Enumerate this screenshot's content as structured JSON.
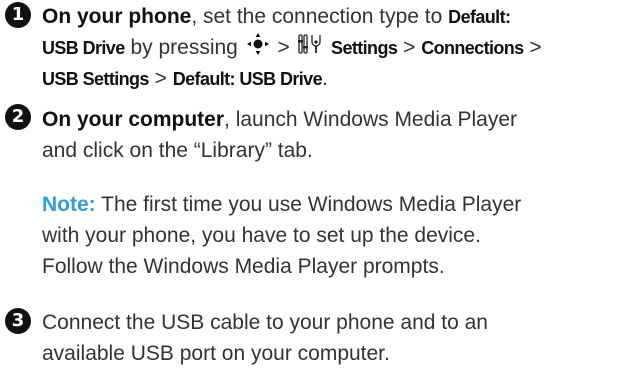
{
  "steps": [
    {
      "number": "1",
      "lead": "On your phone",
      "text_1": ", set the connection type to ",
      "term_1": "Default:",
      "term_2": "USB Drive",
      "text_2": " by pressing ",
      "nav_icon": "navigation-key-icon",
      "sep_1": " > ",
      "settings_icon": "settings-icon",
      "term_3": " Settings",
      "sep_2": " > ",
      "term_4": "Connections",
      "sep_3": " >",
      "term_5": "USB Settings",
      "sep_4": " > ",
      "term_6": "Default: USB Drive",
      "text_3": "."
    },
    {
      "number": "2",
      "lead": "On your computer",
      "text_1": ", launch Windows Media Player",
      "text_2": "and click on the “Library” tab."
    }
  ],
  "note": {
    "label": "Note:",
    "line_1": " The first time you use Windows Media Player",
    "line_2": "with your phone, you have to set up the device.",
    "line_3": "Follow the Windows Media Player prompts."
  },
  "step3": {
    "number": "3",
    "line_1": "Connect the USB cable to your phone and to an",
    "line_2": "available USB port on your computer."
  },
  "colors": {
    "text": "#333333",
    "note_accent": "#2f9fd8",
    "bullet": "#111111"
  }
}
